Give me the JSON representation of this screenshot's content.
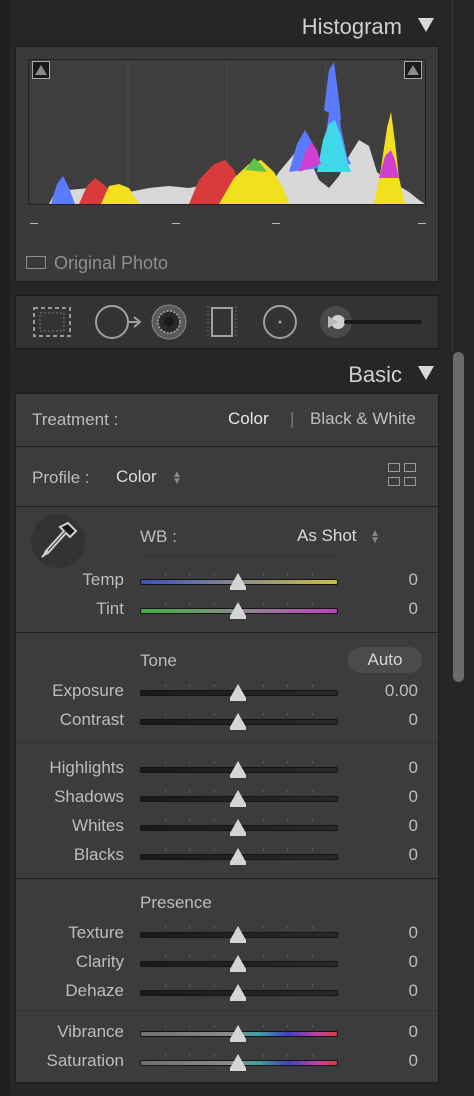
{
  "histogram": {
    "title": "Histogram",
    "original_photo_label": "Original Photo",
    "colors": {
      "red": "#d93a3a",
      "green": "#5fc24a",
      "blue": "#5b7bff",
      "yellow": "#f0e020",
      "cyan": "#40d8e8",
      "magenta": "#d040d0",
      "luminance": "#d8d8d8"
    }
  },
  "tools": [
    {
      "name": "crop-overlay-icon"
    },
    {
      "name": "spot-removal-icon"
    },
    {
      "name": "red-eye-icon"
    },
    {
      "name": "graduated-filter-icon"
    },
    {
      "name": "radial-filter-icon"
    },
    {
      "name": "adjustment-brush-icon"
    }
  ],
  "basic": {
    "title": "Basic",
    "treatment_label": "Treatment :",
    "treatment_color": "Color",
    "treatment_separator": "|",
    "treatment_bw": "Black & White",
    "profile_label": "Profile :",
    "profile_value": "Color",
    "wb_label": "WB :",
    "wb_value": "As Shot",
    "tone_label": "Tone",
    "auto_label": "Auto",
    "presence_label": "Presence",
    "sliders": {
      "temp": {
        "label": "Temp",
        "value": "0",
        "position": 0.5
      },
      "tint": {
        "label": "Tint",
        "value": "0",
        "position": 0.5
      },
      "exposure": {
        "label": "Exposure",
        "value": "0.00",
        "position": 0.5
      },
      "contrast": {
        "label": "Contrast",
        "value": "0",
        "position": 0.5
      },
      "highlights": {
        "label": "Highlights",
        "value": "0",
        "position": 0.5
      },
      "shadows": {
        "label": "Shadows",
        "value": "0",
        "position": 0.5
      },
      "whites": {
        "label": "Whites",
        "value": "0",
        "position": 0.5
      },
      "blacks": {
        "label": "Blacks",
        "value": "0",
        "position": 0.5
      },
      "texture": {
        "label": "Texture",
        "value": "0",
        "position": 0.5
      },
      "clarity": {
        "label": "Clarity",
        "value": "0",
        "position": 0.5
      },
      "dehaze": {
        "label": "Dehaze",
        "value": "0",
        "position": 0.5
      },
      "vibrance": {
        "label": "Vibrance",
        "value": "0",
        "position": 0.5
      },
      "saturation": {
        "label": "Saturation",
        "value": "0",
        "position": 0.5
      }
    }
  }
}
